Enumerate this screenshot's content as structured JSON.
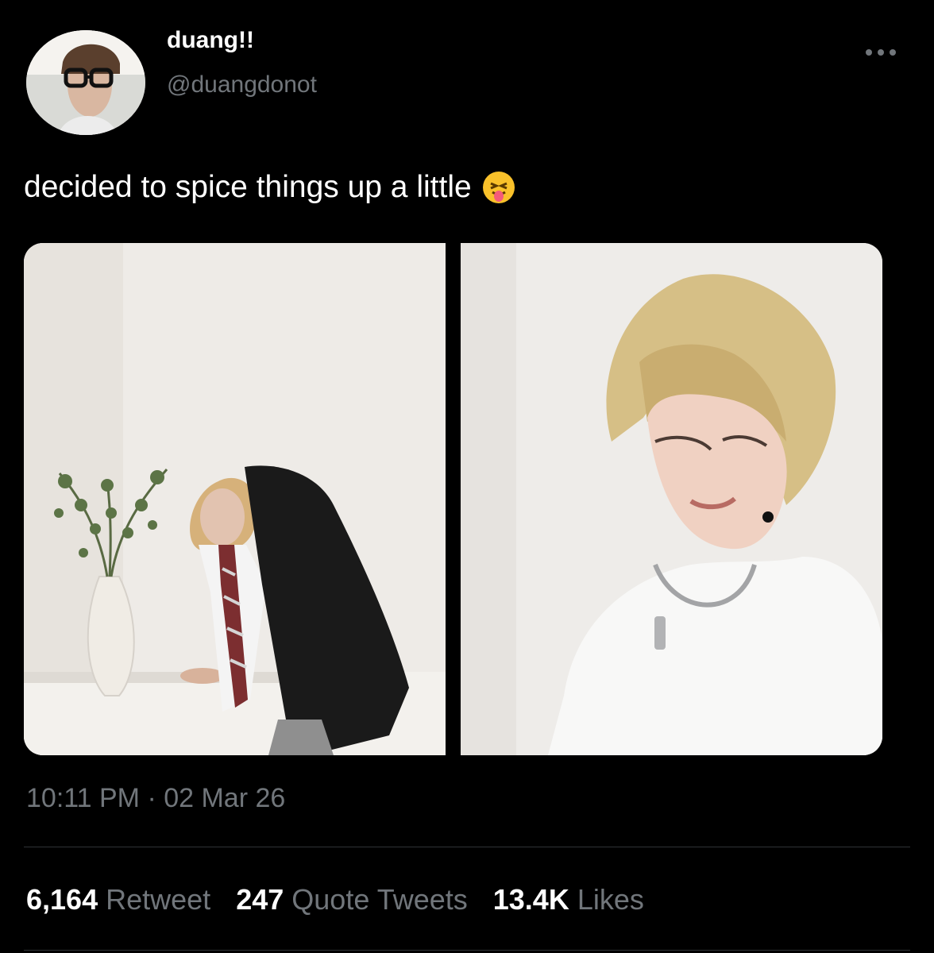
{
  "tweet": {
    "author_name": "duang!!",
    "author_handle": "@duangdonot",
    "text": "decided to spice things up a little",
    "emoji": "face-with-tongue-and-squinting-eyes",
    "time": "10:11 PM · 02 Mar 26"
  },
  "stats": {
    "retweets": {
      "value": "6,164",
      "label": "Retweet"
    },
    "quotes": {
      "value": "247",
      "label": "Quote Tweets"
    },
    "likes": {
      "value": "13.4K",
      "label": "Likes"
    }
  },
  "icons": {
    "more": "more-horizontal-icon"
  },
  "colors": {
    "background": "#000000",
    "text": "#e7e9ea",
    "muted": "#71767b",
    "divider": "#2f3336"
  }
}
